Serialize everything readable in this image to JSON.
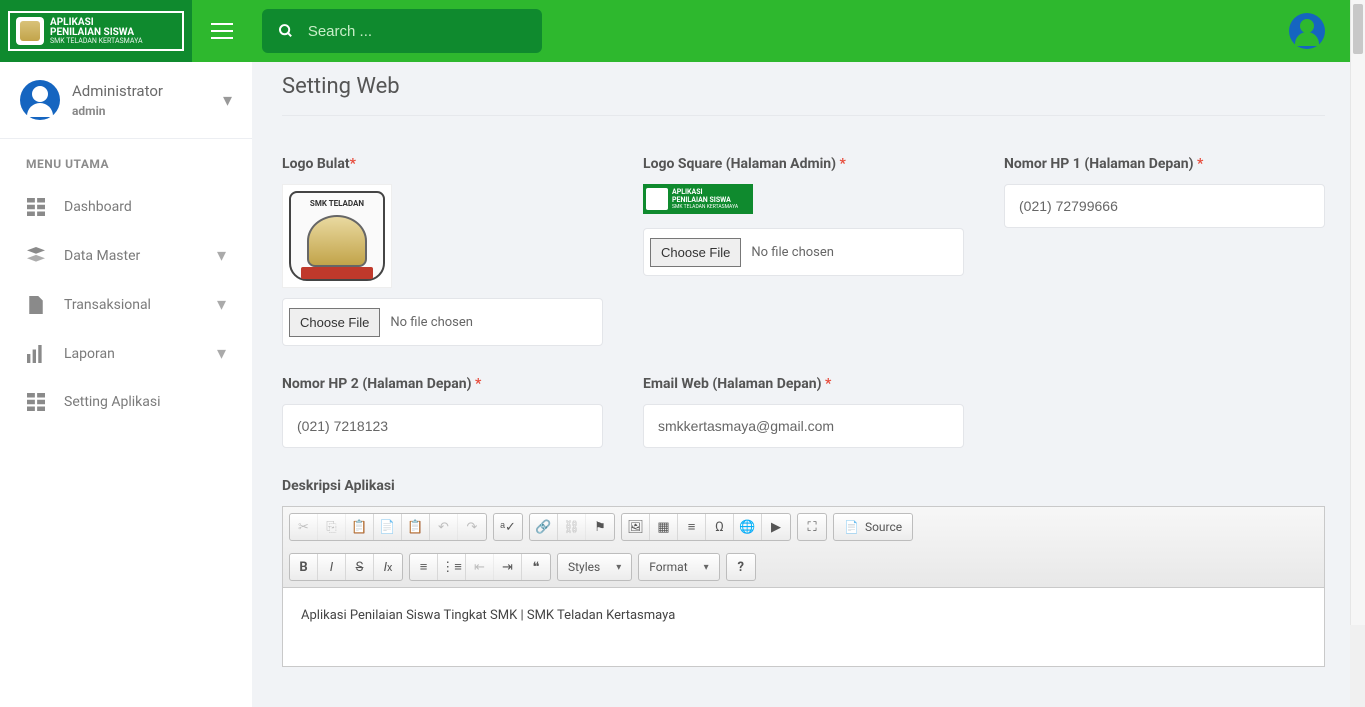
{
  "brand": {
    "line1": "APLIKASI",
    "line2": "PENILAIAN SISWA",
    "line3": "SMK TELADAN KERTASMAYA"
  },
  "search": {
    "placeholder": "Search ..."
  },
  "user": {
    "name": "Administrator",
    "role": "admin"
  },
  "menu_header": "MENU UTAMA",
  "menu": {
    "dashboard": "Dashboard",
    "data_master": "Data Master",
    "transaksional": "Transaksional",
    "laporan": "Laporan",
    "setting": "Setting Aplikasi"
  },
  "page": {
    "title": "Setting Web"
  },
  "labels": {
    "logo_bulat": "Logo Bulat",
    "logo_square": "Logo Square (Halaman Admin) ",
    "hp1": "Nomor HP 1 (Halaman Depan) ",
    "hp2": "Nomor HP 2 (Halaman Depan) ",
    "email": "Email Web (Halaman Depan) ",
    "deskripsi": "Deskripsi Aplikasi"
  },
  "file": {
    "button": "Choose File",
    "nofile": "No file chosen"
  },
  "values": {
    "hp1": "(021) 72799666",
    "hp2": "(021) 7218123",
    "email": "smkkertasmaya@gmail.com"
  },
  "logo_preview": {
    "top_text": "SMK TELADAN"
  },
  "sq_preview": {
    "l1": "APLIKASI",
    "l2": "PENILAIAN SISWA",
    "l3": "SMK TELADAN KERTASMAYA"
  },
  "editor": {
    "styles": "Styles",
    "format": "Format",
    "source": "Source",
    "content": "Aplikasi Penilaian Siswa Tingkat SMK | SMK Teladan Kertasmaya"
  }
}
